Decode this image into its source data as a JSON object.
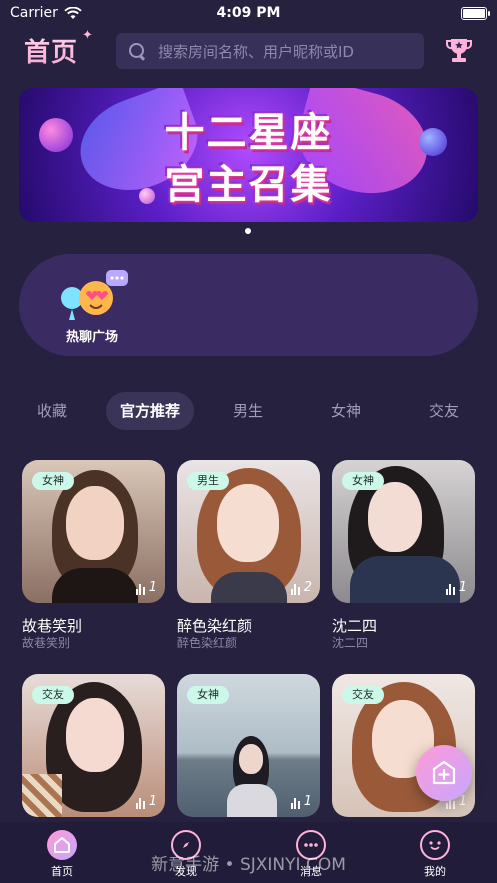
{
  "status_bar": {
    "carrier": "Carrier",
    "time": "4:09 PM"
  },
  "header": {
    "title": "首页",
    "search_placeholder": "搜索房间名称、用户昵称或ID"
  },
  "banner": {
    "line1": "十二星座",
    "line2": "宫主召集"
  },
  "chat_plaza": {
    "label": "热聊广场"
  },
  "tabs": [
    {
      "label": "收藏"
    },
    {
      "label": "官方推荐",
      "active": true
    },
    {
      "label": "男生"
    },
    {
      "label": "女神"
    },
    {
      "label": "交友"
    }
  ],
  "rooms": [
    {
      "tag": "女神",
      "count": "1",
      "name": "故巷笑别",
      "sub": "故巷笑别"
    },
    {
      "tag": "男生",
      "count": "2",
      "name": "醉色染红颜",
      "sub": "醉色染红颜"
    },
    {
      "tag": "女神",
      "count": "1",
      "name": "沈二四",
      "sub": "沈二四"
    },
    {
      "tag": "交友",
      "count": "1"
    },
    {
      "tag": "女神",
      "count": "1"
    },
    {
      "tag": "交友",
      "count": "1"
    }
  ],
  "tabbar": [
    {
      "label": "首页",
      "active": true
    },
    {
      "label": "发现"
    },
    {
      "label": "消息"
    },
    {
      "label": "我的"
    }
  ],
  "watermark": "新意手游 • SJXINYI.COM",
  "colors": {
    "background": "#26213f",
    "tag_bg": "#ccf8ea",
    "active_tab": "#3a3458"
  }
}
